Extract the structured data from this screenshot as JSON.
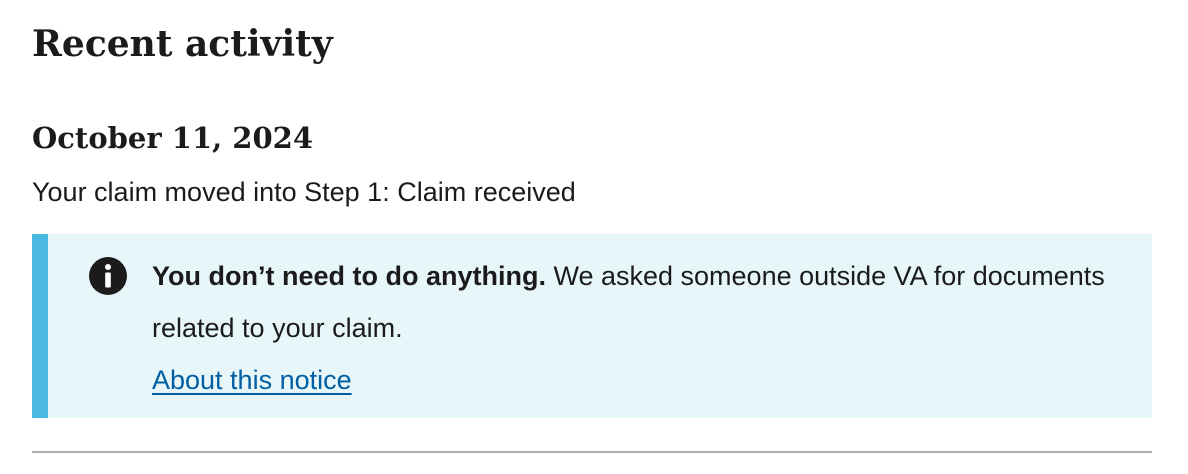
{
  "section": {
    "title": "Recent activity"
  },
  "activity": {
    "date": "October 11, 2024",
    "description": "Your claim moved into Step 1: Claim received"
  },
  "alert": {
    "icon": "info-icon",
    "heading": "You don’t need to do anything.",
    "message": "We asked someone outside VA for documents related to your claim.",
    "link_label": "About this notice",
    "colors": {
      "background": "#e7f6f8",
      "border": "#4ab8e0",
      "link": "#005ea2"
    }
  }
}
